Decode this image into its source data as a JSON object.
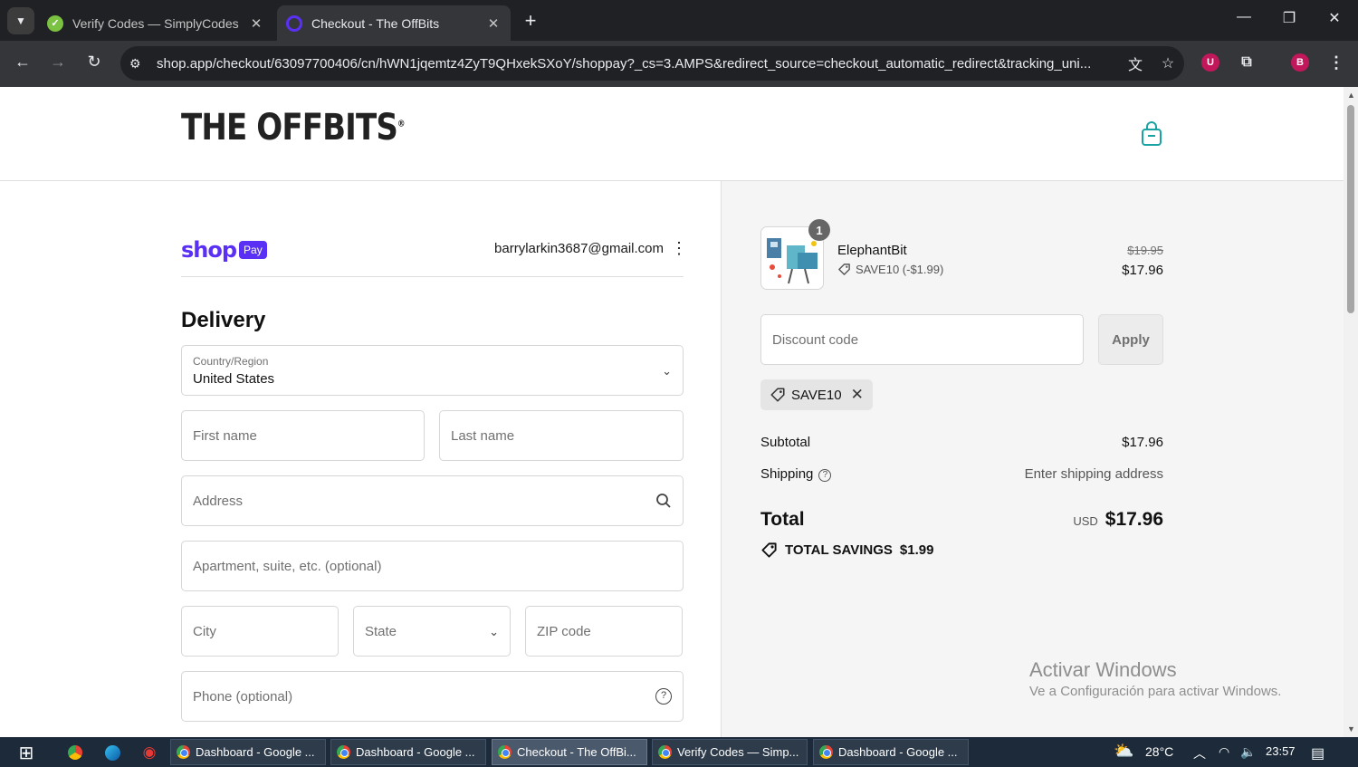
{
  "browser": {
    "tabs": [
      {
        "title": "Verify Codes — SimplyCodes",
        "close": "✕"
      },
      {
        "title": "Checkout - The OffBits",
        "close": "✕"
      }
    ],
    "new_tab": "+",
    "url": "shop.app/checkout/63097700406/cn/hWN1jqemtz4ZyT9QHxekSXoY/shoppay?_cs=3.AMPS&redirect_source=checkout_automatic_redirect&tracking_uni...",
    "profile_initial": "B",
    "extension_initial": "U"
  },
  "header": {
    "logo_text": "THE OFFBITS",
    "logo_mark": "®"
  },
  "shoppay": {
    "word": "shop",
    "badge": "Pay",
    "email": "barrylarkin3687@gmail.com"
  },
  "delivery": {
    "title": "Delivery",
    "country_label": "Country/Region",
    "country_value": "United States",
    "first_name": "First name",
    "last_name": "Last name",
    "address": "Address",
    "apartment": "Apartment, suite, etc. (optional)",
    "city": "City",
    "state": "State",
    "zip": "ZIP code",
    "phone": "Phone (optional)"
  },
  "summary": {
    "product": {
      "name": "ElephantBit",
      "quantity": "1",
      "discount": "SAVE10 (-$1.99)",
      "price_original": "$19.95",
      "price_final": "$17.96"
    },
    "discount_placeholder": "Discount code",
    "apply_label": "Apply",
    "applied_code": "SAVE10",
    "subtotal_label": "Subtotal",
    "subtotal_value": "$17.96",
    "shipping_label": "Shipping",
    "shipping_value": "Enter shipping address",
    "total_label": "Total",
    "currency": "USD",
    "total_value": "$17.96",
    "savings_label": "TOTAL SAVINGS",
    "savings_value": "$1.99"
  },
  "watermark": {
    "line1": "Activar Windows",
    "line2": "Ve a Configuración para activar Windows."
  },
  "taskbar": {
    "apps": [
      {
        "title": "Dashboard - Google ..."
      },
      {
        "title": "Dashboard - Google ..."
      },
      {
        "title": "Checkout - The OffBi..."
      },
      {
        "title": "Verify Codes — Simp..."
      },
      {
        "title": "Dashboard - Google ..."
      }
    ],
    "temperature": "28°C",
    "time": "23:57"
  },
  "colors": {
    "shop_purple": "#5a31f4",
    "cart_teal": "#1aa3a3",
    "chrome_dark": "#202124"
  }
}
